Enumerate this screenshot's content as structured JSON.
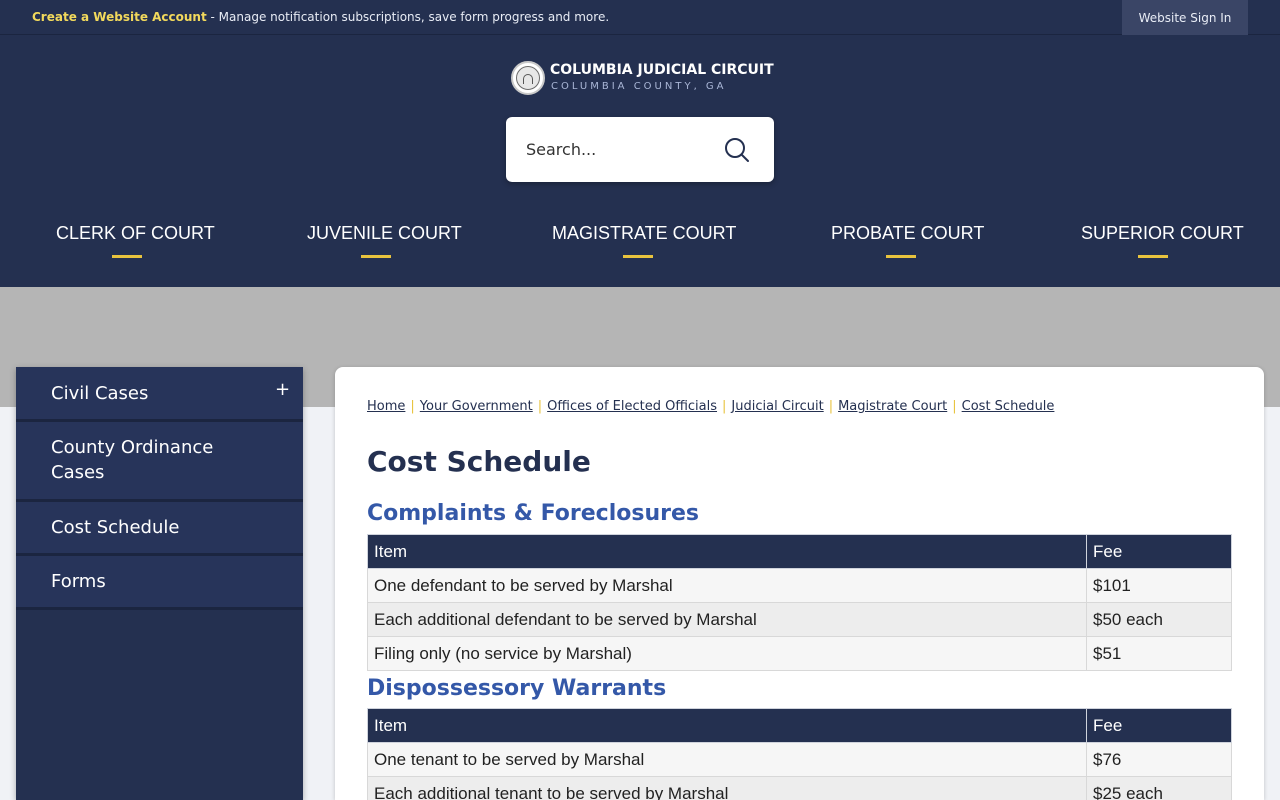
{
  "topbar": {
    "account_link": "Create a Website Account",
    "account_message": " - Manage notification subscriptions, save form progress and more.",
    "signin_label": "Website Sign In"
  },
  "header": {
    "title": "COLUMBIA JUDICIAL CIRCUIT",
    "subtitle": "COLUMBIA COUNTY, GA",
    "search_placeholder": "Search..."
  },
  "nav": {
    "items": [
      {
        "label": "CLERK OF COURT"
      },
      {
        "label": "JUVENILE COURT"
      },
      {
        "label": "MAGISTRATE COURT"
      },
      {
        "label": "PROBATE COURT"
      },
      {
        "label": "SUPERIOR COURT"
      }
    ]
  },
  "sidebar": {
    "items": [
      {
        "label": "Civil Cases",
        "expand": "+"
      },
      {
        "label": "County Ordinance Cases"
      },
      {
        "label": "Cost Schedule"
      },
      {
        "label": "Forms"
      }
    ]
  },
  "breadcrumb": [
    "Home",
    "Your Government",
    "Offices of Elected Officials",
    "Judicial Circuit",
    "Magistrate Court",
    "Cost Schedule"
  ],
  "page_title": "Cost Schedule",
  "sections": [
    {
      "title": "Complaints & Foreclosures",
      "headers": [
        "Item",
        "Fee"
      ],
      "rows": [
        [
          "One defendant to be served by Marshal",
          "$101"
        ],
        [
          "Each additional defendant to be served by Marshal",
          "$50 each"
        ],
        [
          "Filing only (no service by Marshal)",
          "$51"
        ]
      ]
    },
    {
      "title": "Dispossessory Warrants",
      "headers": [
        "Item",
        "Fee"
      ],
      "rows": [
        [
          "One tenant to be served by Marshal",
          "$76"
        ],
        [
          "Each additional tenant to be served by Marshal",
          "$25 each"
        ]
      ]
    }
  ]
}
